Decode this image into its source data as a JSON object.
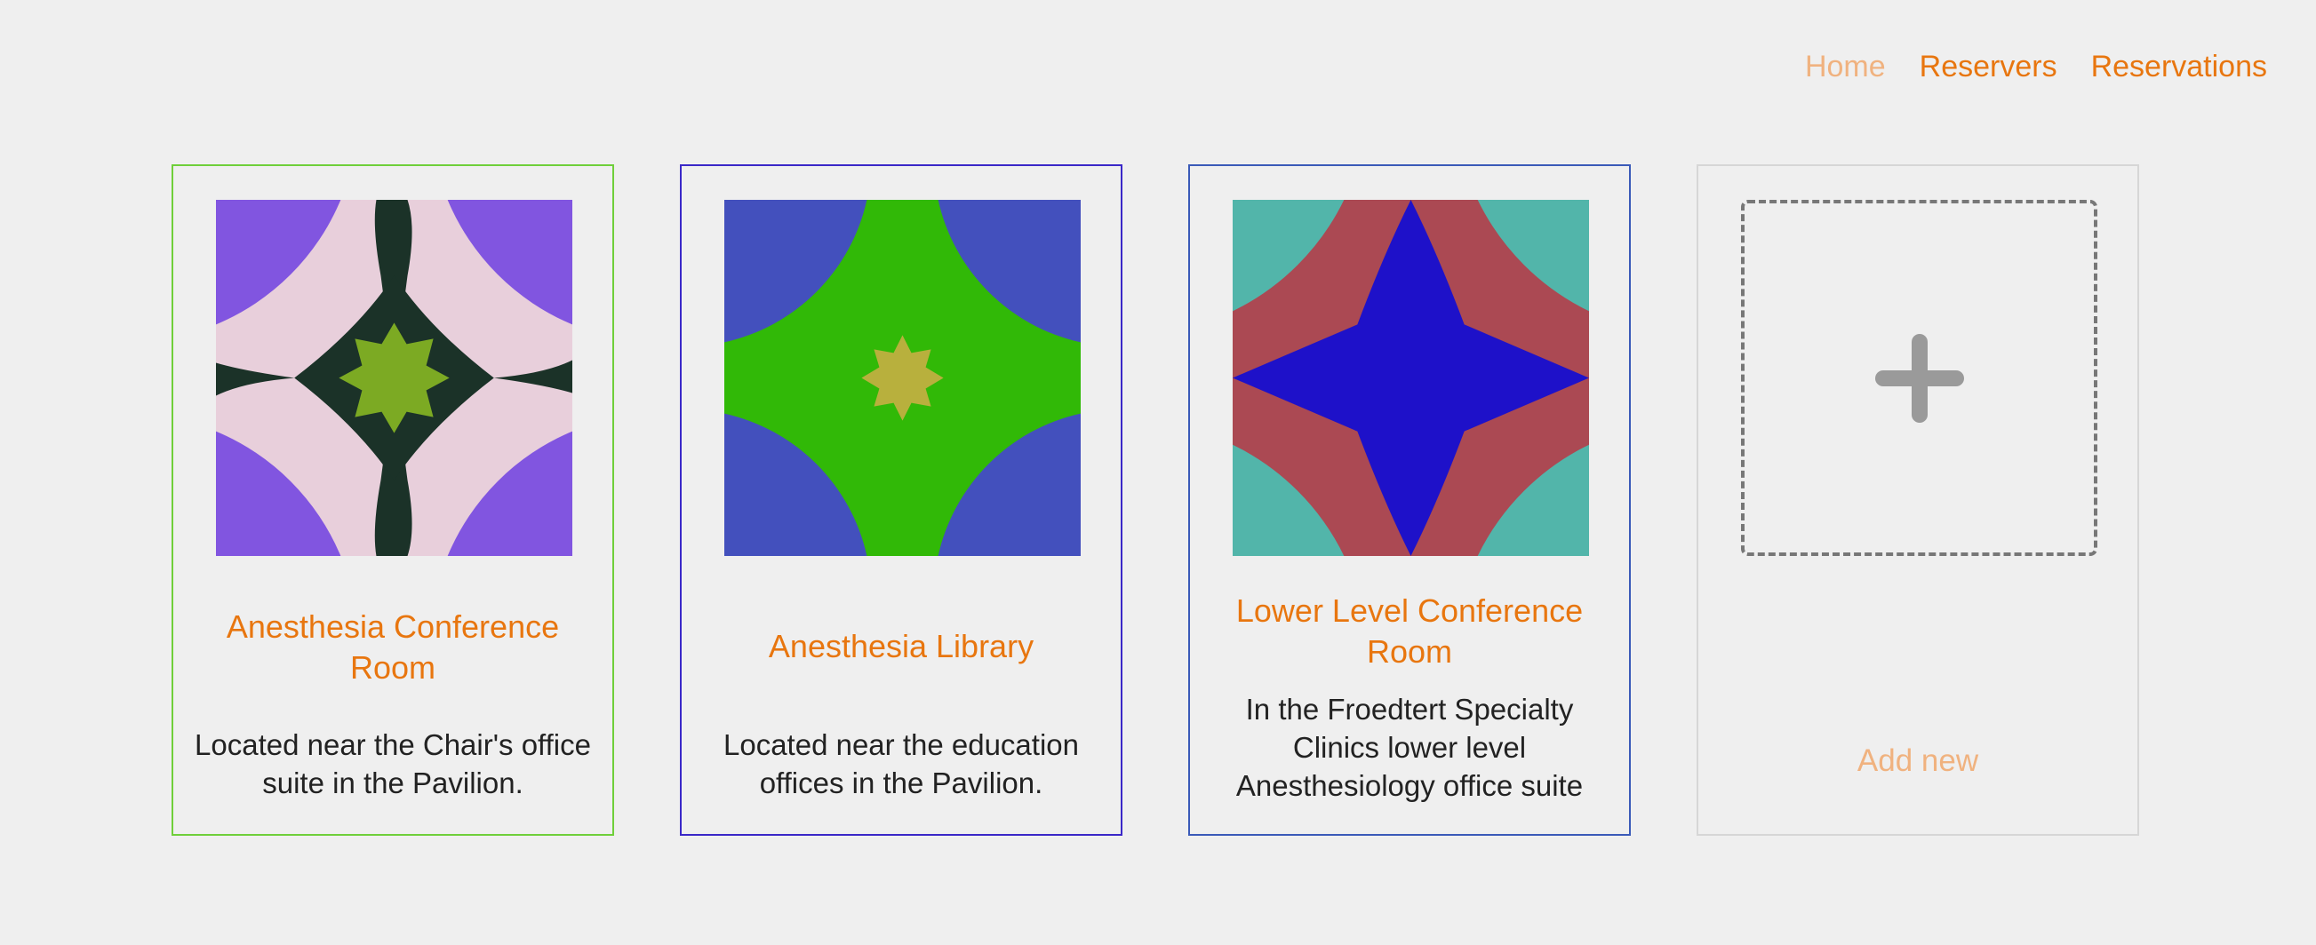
{
  "nav": {
    "home": "Home",
    "reservers": "Reservers",
    "reservations": "Reservations"
  },
  "cards": [
    {
      "title": "Anesthesia Conference Room",
      "description": "Located near the Chair's office suite in the Pavilion.",
      "border_color": "#6fcf3a",
      "colors": {
        "corner": "#8155e0",
        "petal": "#e8cfdb",
        "dark": "#1b3228",
        "star": "#7caa23"
      }
    },
    {
      "title": "Anesthesia Library",
      "description": "Located near the education offices in the Pavilion.",
      "border_color": "#3a28c8",
      "colors": {
        "corner": "#4350bd",
        "petal": "#31b907",
        "star": "#b8b03d"
      }
    },
    {
      "title": "Lower Level Conference Room",
      "description": "In the Froedtert Specialty Clinics lower level Anesthesiology office suite",
      "border_color": "#3a5ab8",
      "colors": {
        "corner": "#52b5aa",
        "petal": "#ab4953",
        "star": "#1e11c9"
      }
    }
  ],
  "add_card": {
    "label": "Add new",
    "icon": "plus-icon"
  }
}
